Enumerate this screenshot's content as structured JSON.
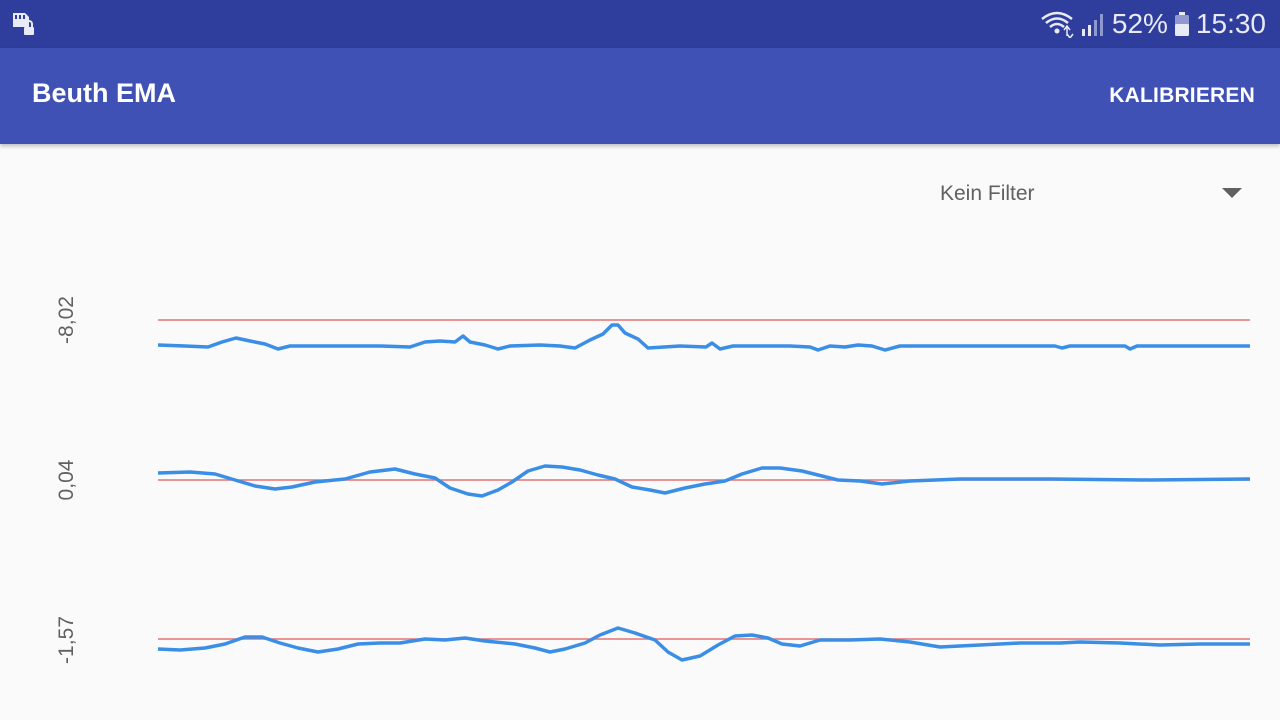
{
  "status_bar": {
    "battery": "52%",
    "time": "15:30",
    "icons": [
      "sd-card-lock-icon",
      "wifi-icon",
      "signal-icon",
      "battery-icon"
    ]
  },
  "app_bar": {
    "title": "Beuth EMA",
    "action": "KALIBRIEREN"
  },
  "filter": {
    "selected": "Kein Filter"
  },
  "colors": {
    "status_bar": "#2f3e9c",
    "app_bar": "#3f51b5",
    "signal_line": "#3a8ee6",
    "reference_line": "#e57373",
    "background": "#fafafa"
  },
  "graphs": [
    {
      "label": "-8,02"
    },
    {
      "label": "0,04"
    },
    {
      "label": "-1,57"
    }
  ]
}
